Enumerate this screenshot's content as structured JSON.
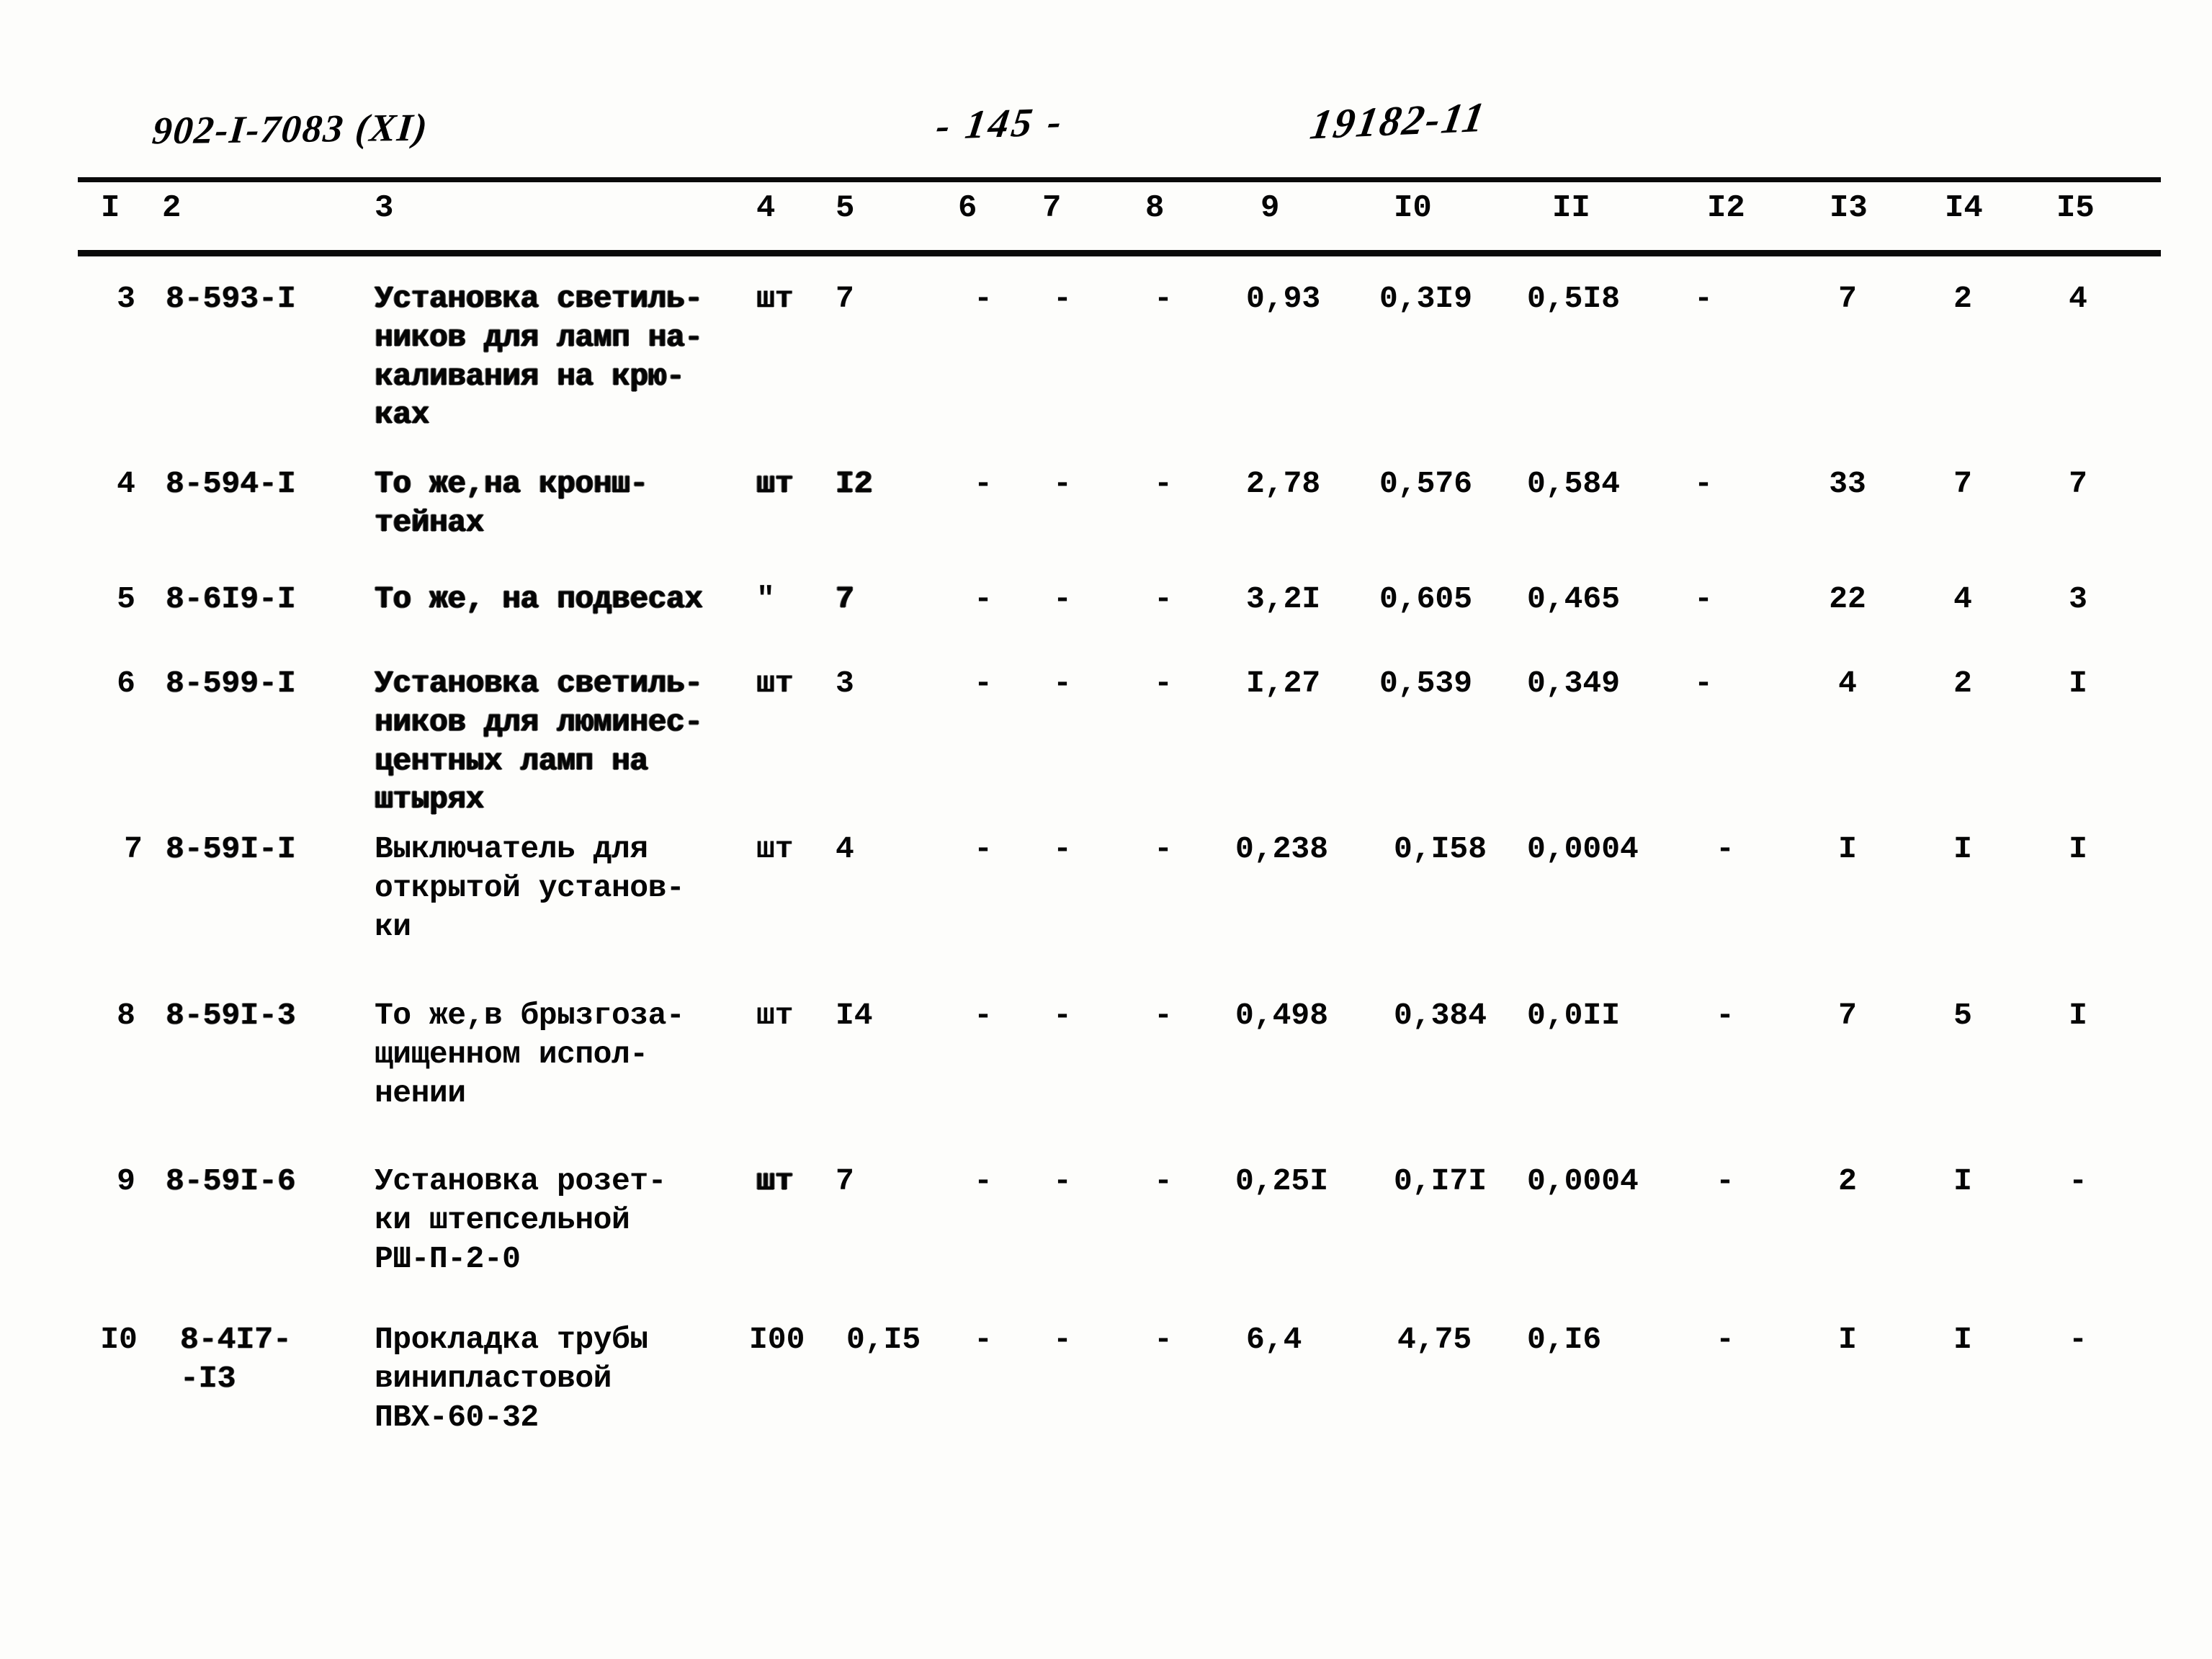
{
  "header": {
    "doc_code": "902-I-7083 (XI)",
    "page_number": "- 145 -",
    "sheet_code": "19182-11"
  },
  "table": {
    "column_numbers": [
      "I",
      "2",
      "3",
      "4",
      "5",
      "6",
      "7",
      "8",
      "9",
      "I0",
      "II",
      "I2",
      "I3",
      "I4",
      "I5"
    ],
    "rows": [
      {
        "c1": "3",
        "c2": "8-593-I",
        "c3": "Установка светиль-\nников для ламп на-\nкаливания на крю-\nках",
        "c4": "шт",
        "c5": "7",
        "c6": "-",
        "c7": "-",
        "c8": "-",
        "c9": "0,93",
        "c10": "0,3I9",
        "c11": "0,5I8",
        "c12": "-",
        "c13": "7",
        "c14": "2",
        "c15": "4"
      },
      {
        "c1": "4",
        "c2": "8-594-I",
        "c3": "То же,на кронш-\nтейнах",
        "c4": "шт",
        "c5": "I2",
        "c6": "-",
        "c7": "-",
        "c8": "-",
        "c9": "2,78",
        "c10": "0,576",
        "c11": "0,584",
        "c12": "-",
        "c13": "33",
        "c14": "7",
        "c15": "7"
      },
      {
        "c1": "5",
        "c2": "8-6I9-I",
        "c3": "То же, на подвесах",
        "c4": "\"",
        "c5": "7",
        "c6": "-",
        "c7": "-",
        "c8": "-",
        "c9": "3,2I",
        "c10": "0,605",
        "c11": "0,465",
        "c12": "-",
        "c13": "22",
        "c14": "4",
        "c15": "3"
      },
      {
        "c1": "6",
        "c2": "8-599-I",
        "c3": "Установка светиль-\nников для люминес-\nцентных ламп на\nштырях",
        "c4": "шт",
        "c5": "3",
        "c6": "-",
        "c7": "-",
        "c8": "-",
        "c9": "I,27",
        "c10": "0,539",
        "c11": "0,349",
        "c12": "-",
        "c13": "4",
        "c14": "2",
        "c15": "I"
      },
      {
        "c1": "7",
        "c2": "8-59I-I",
        "c3": "Выключатель для\nоткрытой установ-\nки",
        "c4": "шт",
        "c5": "4",
        "c6": "-",
        "c7": "-",
        "c8": "-",
        "c9": "0,238",
        "c10": "0,I58",
        "c11": "0,0004",
        "c12": "-",
        "c13": "I",
        "c14": "I",
        "c15": "I"
      },
      {
        "c1": "8",
        "c2": "8-59I-3",
        "c3": "То же,в брызгоза-\nщищенном испол-\nнении",
        "c4": "шт",
        "c5": "I4",
        "c6": "-",
        "c7": "-",
        "c8": "-",
        "c9": "0,498",
        "c10": "0,384",
        "c11": "0,0II",
        "c12": "-",
        "c13": "7",
        "c14": "5",
        "c15": "I"
      },
      {
        "c1": "9",
        "c2": "8-59I-6",
        "c3": "Установка розет-\nки штепсельной\nРШ-П-2-0",
        "c4": "шт",
        "c5": "7",
        "c6": "-",
        "c7": "-",
        "c8": "-",
        "c9": "0,25I",
        "c10": "0,I7I",
        "c11": "0,0004",
        "c12": "-",
        "c13": "2",
        "c14": "I",
        "c15": "-"
      },
      {
        "c1": "I0",
        "c2": "8-4I7-\n-I3",
        "c3": "Прокладка трубы\nвинипластовой\nПВХ-60-32",
        "c4": "I00",
        "c5": "0,I5",
        "c6": "-",
        "c7": "-",
        "c8": "-",
        "c9": "6,4",
        "c10": "4,75",
        "c11": "0,I6",
        "c12": "-",
        "c13": "I",
        "c14": "I",
        "c15": "-"
      }
    ]
  }
}
